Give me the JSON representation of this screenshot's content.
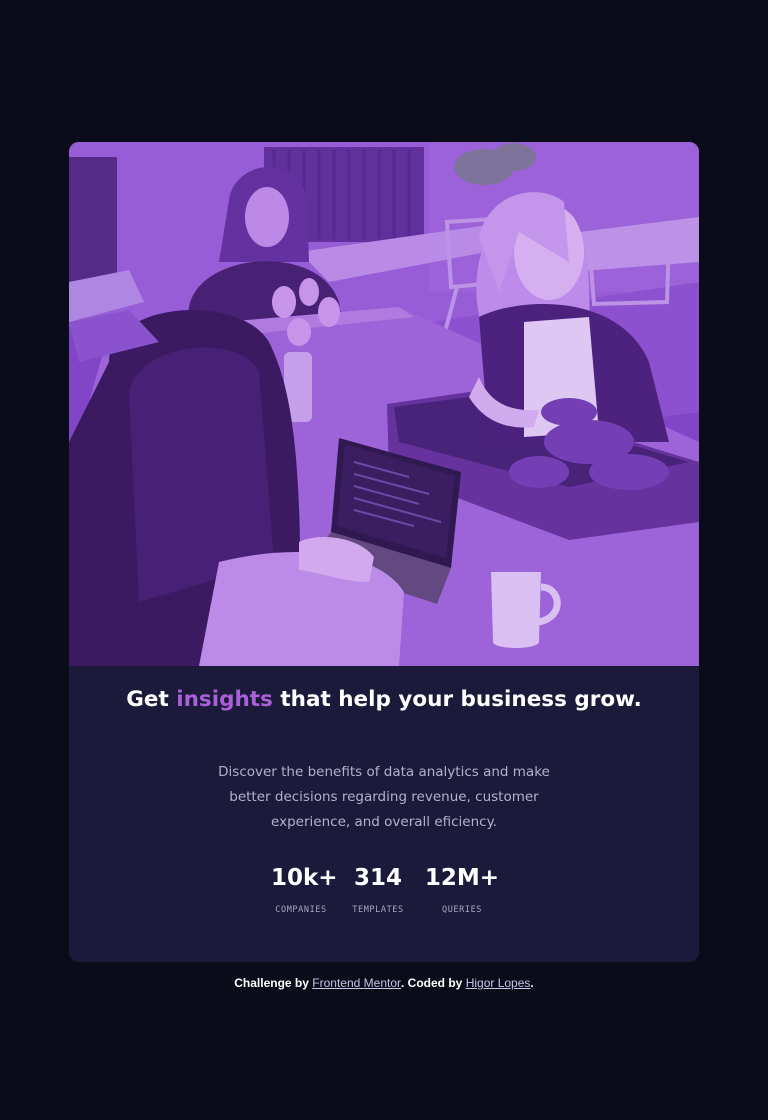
{
  "card": {
    "image": {
      "description_icon": "team-working-photo",
      "overlay_color": "#8a44d8"
    },
    "title": {
      "before": "Get",
      "accent": "insights",
      "after": "that help your business grow."
    },
    "description": "Discover the benefits of data analytics and make better decisions regarding revenue, customer experience, and overall eficiency.",
    "stats": [
      {
        "value": "10k+",
        "label": "COMPANIES"
      },
      {
        "value": "314",
        "label": "TEMPLATES"
      },
      {
        "value": "12M+",
        "label": "QUERIES"
      }
    ]
  },
  "footer": {
    "prefix": "Challenge by",
    "mentor_link": "Frontend Mentor",
    "middle": ". Coded by",
    "author_link": "Higor Lopes",
    "suffix": "."
  },
  "colors": {
    "background": "#0a0c1a",
    "card": "#1c1a3b",
    "accent": "#a960d8",
    "text": "#ffffff",
    "muted": "#b4b0cc"
  }
}
